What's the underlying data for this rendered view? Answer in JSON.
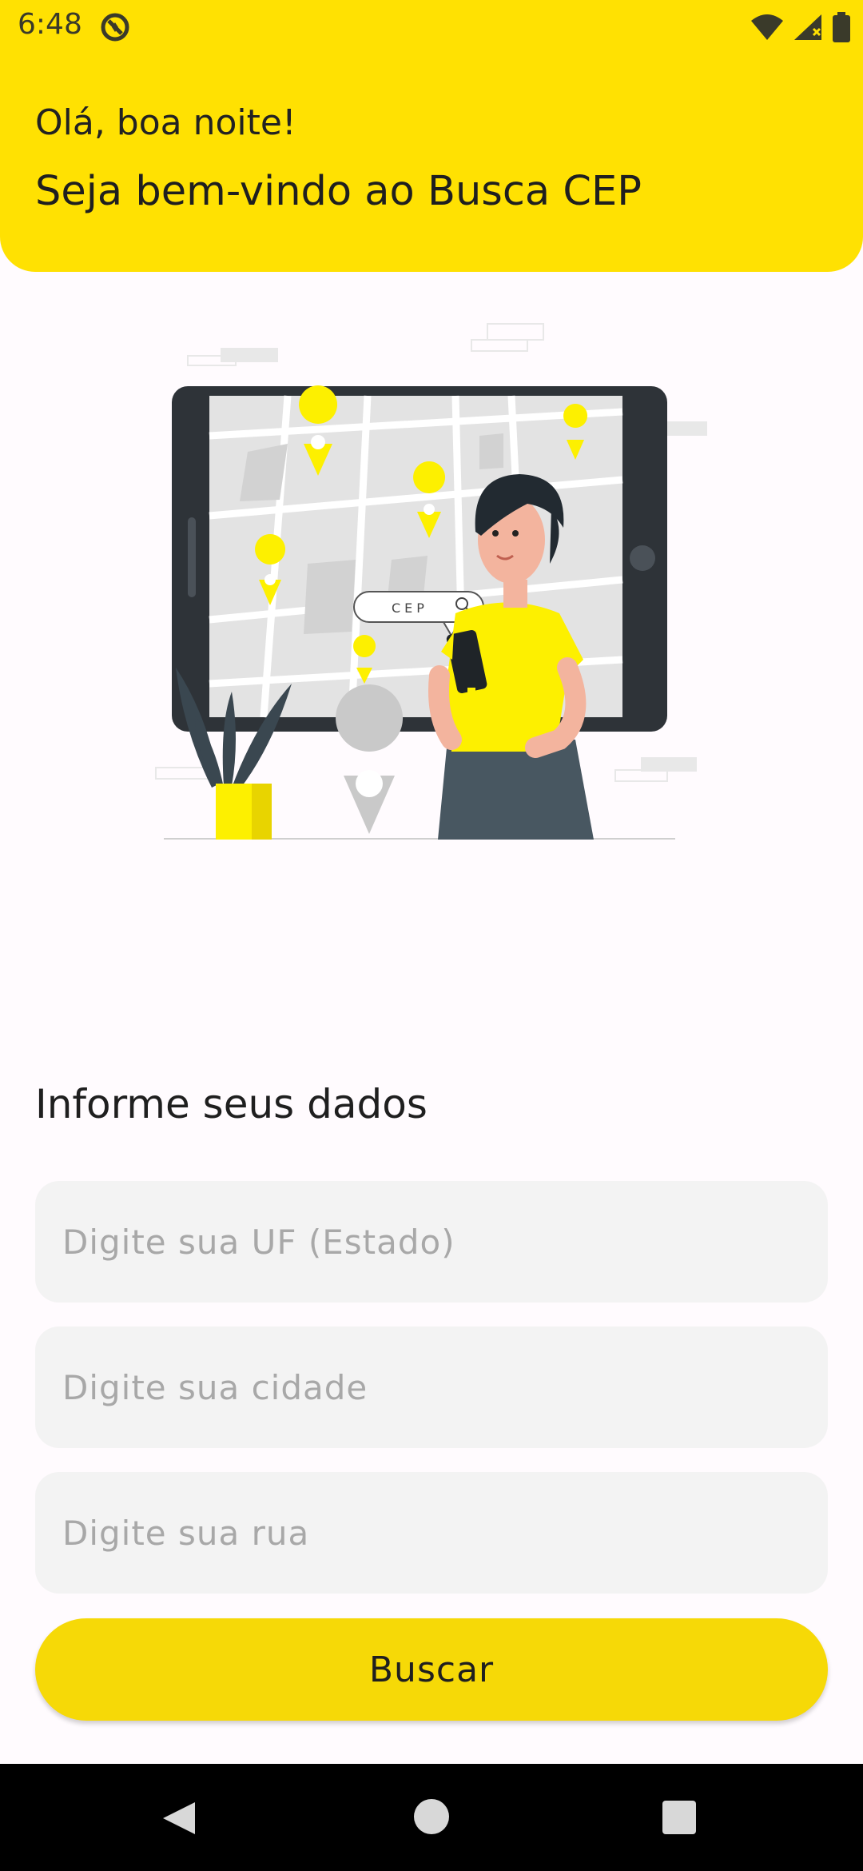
{
  "status_bar": {
    "time": "6:48",
    "icons": [
      "app-notification-icon",
      "wifi-icon",
      "signal-icon",
      "battery-icon"
    ]
  },
  "header": {
    "greeting": "Olá, boa noite!",
    "welcome": "Seja bem-vindo ao Busca CEP"
  },
  "illustration": {
    "search_bubble_text": "CEP",
    "icon": "map-tablet-person-illustration"
  },
  "form": {
    "title": "Informe seus dados",
    "uf_placeholder": "Digite sua UF (Estado)",
    "uf_value": "",
    "city_placeholder": "Digite sua cidade",
    "city_value": "",
    "street_placeholder": "Digite sua rua",
    "street_value": "",
    "search_label": "Buscar"
  },
  "nav_bar": {
    "icons": [
      "back-icon",
      "home-icon",
      "recent-apps-icon"
    ]
  },
  "colors": {
    "accent": "#ffe102",
    "button": "#f6d907",
    "field_bg": "#f3f3f3"
  }
}
